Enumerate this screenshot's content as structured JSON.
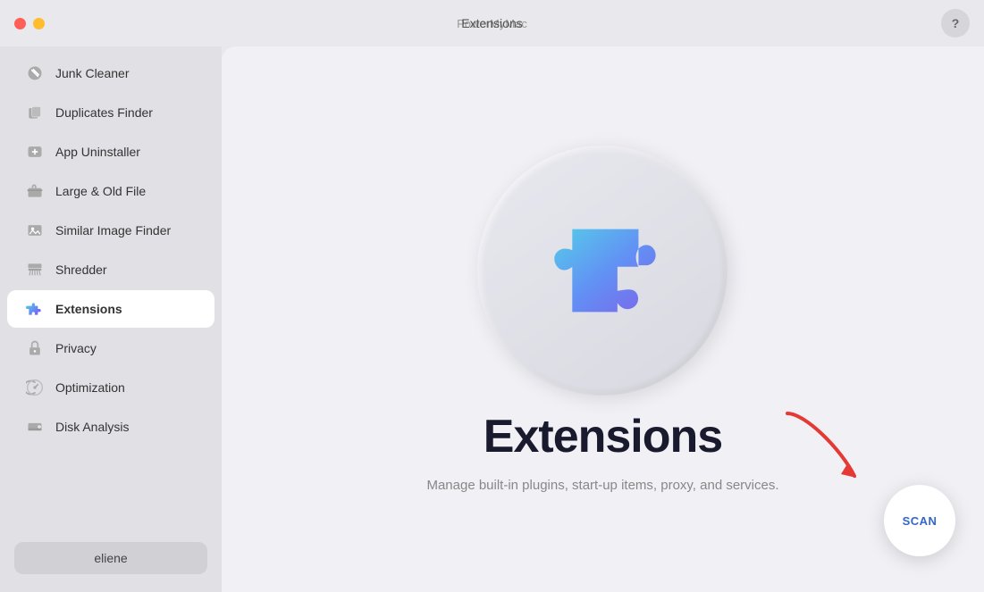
{
  "titlebar": {
    "app_name": "PowerMyMac",
    "page_title": "Extensions",
    "help_label": "?"
  },
  "sidebar": {
    "items": [
      {
        "id": "junk-cleaner",
        "label": "Junk Cleaner",
        "icon": "broom"
      },
      {
        "id": "duplicates-finder",
        "label": "Duplicates Finder",
        "icon": "files"
      },
      {
        "id": "app-uninstaller",
        "label": "App Uninstaller",
        "icon": "app-uninstall"
      },
      {
        "id": "large-old-file",
        "label": "Large & Old File",
        "icon": "briefcase"
      },
      {
        "id": "similar-image-finder",
        "label": "Similar Image Finder",
        "icon": "image"
      },
      {
        "id": "shredder",
        "label": "Shredder",
        "icon": "shredder"
      },
      {
        "id": "extensions",
        "label": "Extensions",
        "icon": "extensions",
        "active": true
      },
      {
        "id": "privacy",
        "label": "Privacy",
        "icon": "lock"
      },
      {
        "id": "optimization",
        "label": "Optimization",
        "icon": "speed"
      },
      {
        "id": "disk-analysis",
        "label": "Disk Analysis",
        "icon": "disk"
      }
    ],
    "user": {
      "label": "eliene"
    }
  },
  "content": {
    "title": "Extensions",
    "subtitle": "Manage built-in plugins, start-up items, proxy, and services.",
    "scan_label": "SCAN"
  }
}
